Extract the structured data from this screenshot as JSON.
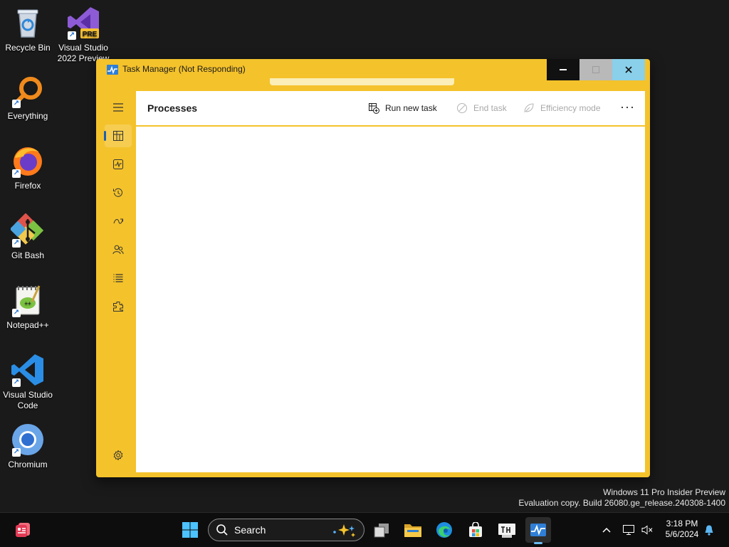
{
  "desktop": {
    "icons": [
      {
        "label": "Recycle Bin"
      },
      {
        "label": "Visual Studio\n2022 Preview",
        "badge": "PRE"
      },
      {
        "label": "Everything"
      },
      {
        "label": "Firefox"
      },
      {
        "label": "Git Bash"
      },
      {
        "label": "Notepad++"
      },
      {
        "label": "Visual Studio\nCode"
      },
      {
        "label": "Chromium"
      }
    ],
    "watermark": {
      "line1": "Windows 11 Pro Insider Preview",
      "line2": "Evaluation copy. Build 26080.ge_release.240308-1400"
    }
  },
  "window": {
    "title": "Task Manager (Not Responding)",
    "page_title": "Processes",
    "commands": {
      "run_new_task": "Run new task",
      "end_task": "End task",
      "efficiency_mode": "Efficiency mode",
      "more": "···"
    },
    "nav": [
      "menu-icon",
      "processes-icon",
      "performance-icon",
      "app-history-icon",
      "startup-apps-icon",
      "users-icon",
      "details-icon",
      "services-icon",
      "settings-icon"
    ],
    "colors": {
      "frame": "#f4c22b",
      "accent": "#1d5fb0"
    }
  },
  "taskbar": {
    "search_label": "Search",
    "clock_time": "3:18 PM",
    "clock_date": "5/6/2024"
  }
}
